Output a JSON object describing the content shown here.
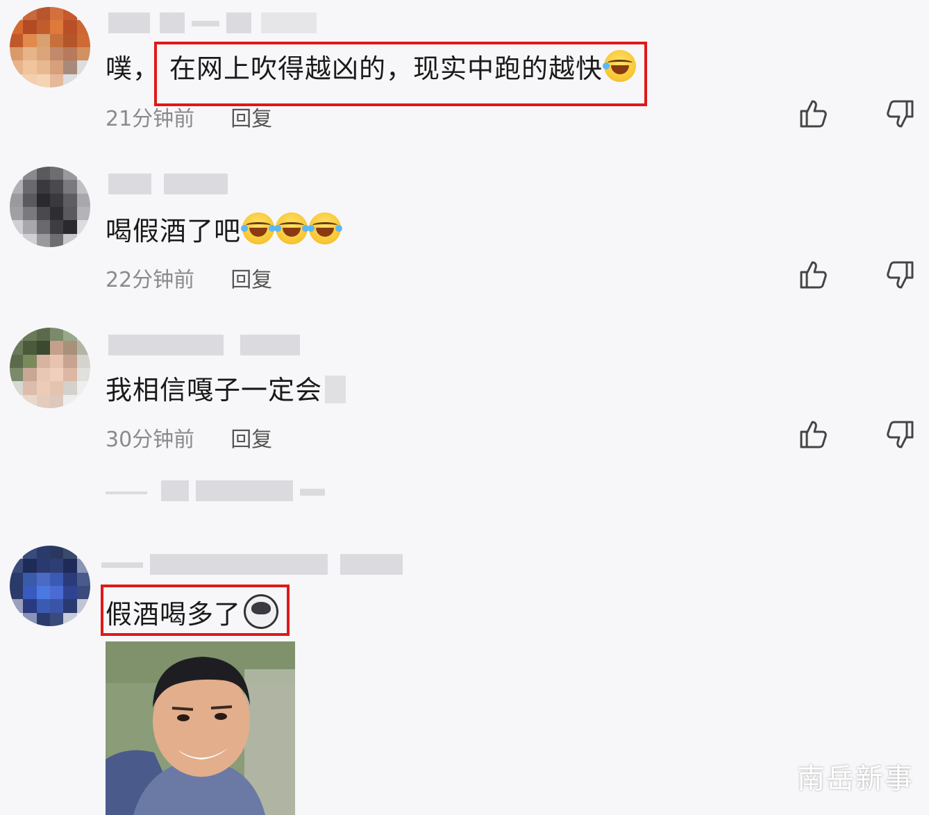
{
  "comments": [
    {
      "text_prefix": "噗，",
      "text_boxed": "在网上吹得越凶的，现实中跑的越快",
      "time": "21分钟前",
      "reply": "回复",
      "emoji": "rofl-emoji"
    },
    {
      "text": "喝假酒了吧",
      "time": "22分钟前",
      "reply": "回复",
      "emoji": "laugh-cry-emoji"
    },
    {
      "text": "我相信嘎子一定会",
      "time": "30分钟前",
      "reply": "回复"
    },
    {
      "text": "假酒喝多了",
      "emoji": "dog-emoji"
    }
  ],
  "watermark": "南岳新事",
  "colors": {
    "highlight": "#e01818",
    "meta": "#8a8a8e",
    "background": "#f7f7f9"
  }
}
